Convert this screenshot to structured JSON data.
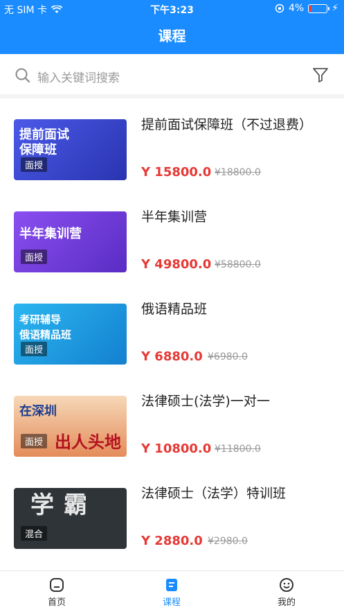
{
  "status_bar": {
    "carrier": "无 SIM 卡",
    "time": "下午3:23",
    "battery": "4%"
  },
  "header": {
    "title": "课程"
  },
  "search": {
    "placeholder": "输入关键词搜索"
  },
  "courses": [
    {
      "thumb_text": "提前面试\n保障班",
      "tag": "面授",
      "name": "提前面试保障班（不过退费）",
      "price": "Y 15800.0",
      "original": "¥18800.0",
      "thumb_color": "#3b4bd8"
    },
    {
      "thumb_text": "半年集训营",
      "tag": "面授",
      "name": "半年集训营",
      "price": "Y 49800.0",
      "original": "¥58800.0",
      "thumb_color": "#7b3fe4"
    },
    {
      "thumb_text": "考研辅导\n俄语精品班",
      "tag": "面授",
      "name": "俄语精品班",
      "price": "Y 6880.0",
      "original": "¥6980.0",
      "thumb_color": "#1aa3e8"
    },
    {
      "thumb_text": "在深圳\n出人头地",
      "tag": "面授",
      "name": "法律硕士(法学)一对一",
      "price": "Y 10800.0",
      "original": "¥11800.0",
      "thumb_color": "#e9a36a"
    },
    {
      "thumb_text": "学 霸",
      "tag": "混合",
      "name": "法律硕士（法学）特训班",
      "price": "Y 2880.0",
      "original": "¥2980.0",
      "thumb_color": "#2e3438"
    }
  ],
  "tabbar": [
    {
      "label": "首页",
      "icon": "home-icon"
    },
    {
      "label": "课程",
      "icon": "course-icon",
      "active": true
    },
    {
      "label": "我的",
      "icon": "profile-icon"
    }
  ],
  "colors": {
    "primary": "#1a8cff",
    "price": "#e53935"
  }
}
